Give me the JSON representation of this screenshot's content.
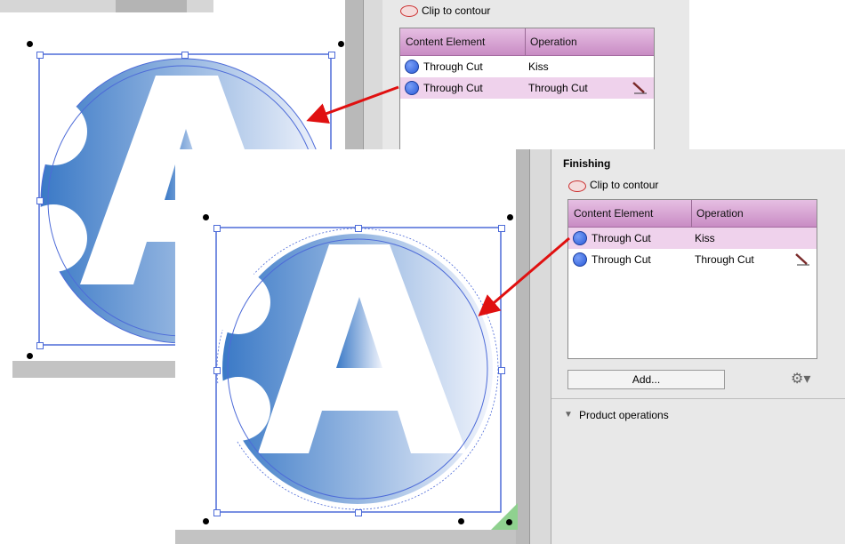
{
  "top_panel": {
    "clip_label": "Clip to contour",
    "columns": [
      "Content Element",
      "Operation"
    ],
    "rows": [
      {
        "element": "Through Cut",
        "operation": "Kiss"
      },
      {
        "element": "Through Cut",
        "operation": "Through Cut"
      }
    ]
  },
  "bottom_panel": {
    "section_title": "Finishing",
    "clip_label": "Clip to contour",
    "columns": [
      "Content Element",
      "Operation"
    ],
    "rows": [
      {
        "element": "Through Cut",
        "operation": "Kiss"
      },
      {
        "element": "Through Cut",
        "operation": "Through Cut"
      }
    ],
    "add_label": "Add...",
    "product_operations_label": "Product operations"
  },
  "artwork": {
    "letter": "A"
  },
  "colors": {
    "accent_arrow": "#e01010",
    "selection_blue": "#4d6bd8",
    "header_pink": "#d59ed0",
    "selected_row": "#efd2ec"
  },
  "icons": [
    "circle-dot-icon",
    "knife-icon",
    "gear-icon",
    "triangle-down-icon",
    "clip-contour-icon"
  ]
}
